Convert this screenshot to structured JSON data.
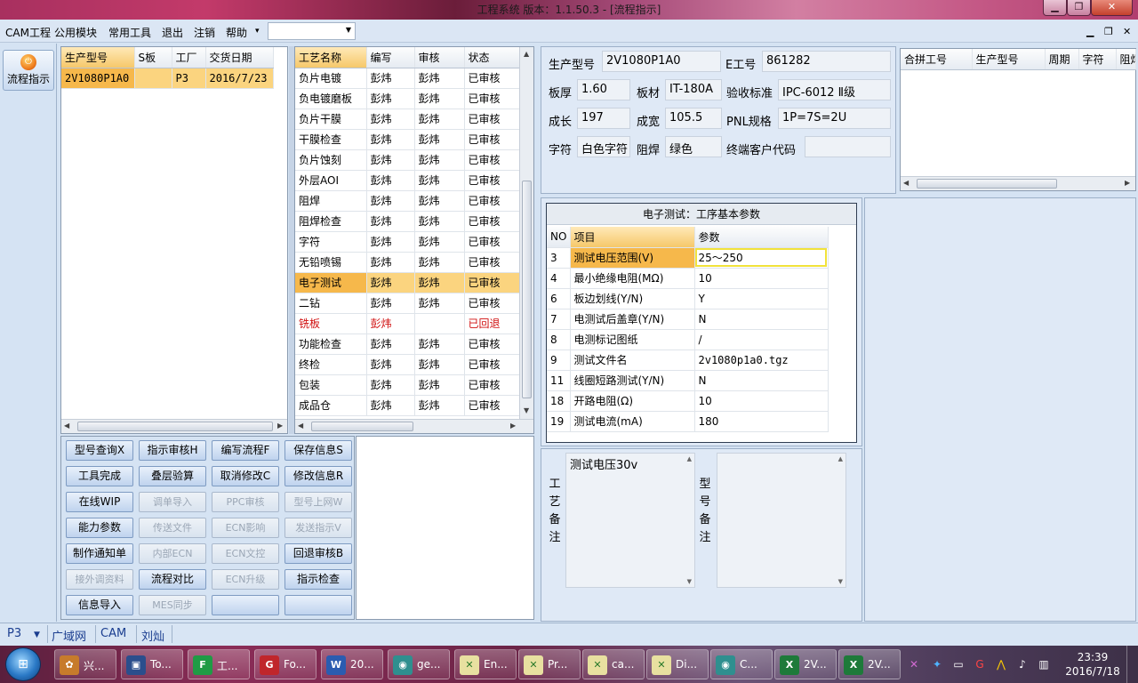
{
  "window": {
    "title": "工程系统   版本：1.1.50.3 - [流程指示]"
  },
  "menu": {
    "items": [
      "CAM工程",
      "公用模块",
      "常用工具",
      "退出",
      "注销",
      "帮助"
    ],
    "combo_value": ""
  },
  "nav": {
    "flow_label": "流程指示"
  },
  "model_grid": {
    "headers": [
      "生产型号",
      "S板",
      "工厂",
      "交货日期"
    ],
    "rows": [
      {
        "model": "2V1080P1A0",
        "s": "",
        "factory": "P3",
        "date": "2016/7/23"
      }
    ]
  },
  "process_grid": {
    "headers": [
      "工艺名称",
      "编写",
      "审核",
      "状态"
    ],
    "rows": [
      {
        "name": "负片电镀",
        "writer": "彭炜",
        "reviewer": "彭炜",
        "status": "已审核"
      },
      {
        "name": "负电镀磨板",
        "writer": "彭炜",
        "reviewer": "彭炜",
        "status": "已审核"
      },
      {
        "name": "负片干膜",
        "writer": "彭炜",
        "reviewer": "彭炜",
        "status": "已审核"
      },
      {
        "name": "干膜检查",
        "writer": "彭炜",
        "reviewer": "彭炜",
        "status": "已审核"
      },
      {
        "name": "负片蚀刻",
        "writer": "彭炜",
        "reviewer": "彭炜",
        "status": "已审核"
      },
      {
        "name": "外层AOI",
        "writer": "彭炜",
        "reviewer": "彭炜",
        "status": "已审核"
      },
      {
        "name": "阻焊",
        "writer": "彭炜",
        "reviewer": "彭炜",
        "status": "已审核"
      },
      {
        "name": "阻焊检查",
        "writer": "彭炜",
        "reviewer": "彭炜",
        "status": "已审核"
      },
      {
        "name": "字符",
        "writer": "彭炜",
        "reviewer": "彭炜",
        "status": "已审核"
      },
      {
        "name": "无铅喷锡",
        "writer": "彭炜",
        "reviewer": "彭炜",
        "status": "已审核"
      },
      {
        "name": "电子测试",
        "writer": "彭炜",
        "reviewer": "彭炜",
        "status": "已审核"
      },
      {
        "name": "二钻",
        "writer": "彭炜",
        "reviewer": "彭炜",
        "status": "已审核"
      },
      {
        "name": "铣板",
        "writer": "彭炜",
        "reviewer": "",
        "status": "已回退"
      },
      {
        "name": "功能检查",
        "writer": "彭炜",
        "reviewer": "彭炜",
        "status": "已审核"
      },
      {
        "name": "终检",
        "writer": "彭炜",
        "reviewer": "彭炜",
        "status": "已审核"
      },
      {
        "name": "包装",
        "writer": "彭炜",
        "reviewer": "彭炜",
        "status": "已审核"
      },
      {
        "name": "成品仓",
        "writer": "彭炜",
        "reviewer": "彭炜",
        "status": "已审核"
      }
    ]
  },
  "buttons": [
    [
      "型号查询X",
      "指示审核H",
      "编写流程F",
      "保存信息S"
    ],
    [
      "工具完成",
      "叠层验算",
      "取消修改C",
      "修改信息R"
    ],
    [
      "在线WIP",
      "调单导入",
      "PPC审核",
      "型号上网W"
    ],
    [
      "能力参数",
      "传送文件",
      "ECN影响",
      "发送指示V"
    ],
    [
      "制作通知单",
      "内部ECN",
      "ECN文控",
      "回退审核B"
    ],
    [
      "接外调资料",
      "流程对比",
      "ECN升级",
      "指示检查"
    ],
    [
      "信息导入",
      "MES同步",
      "",
      ""
    ]
  ],
  "info": {
    "model_label": "生产型号",
    "model_value": "2V1080P1A0",
    "e_label": "E工号",
    "e_value": "861282",
    "thickness_label": "板厚",
    "thickness_value": "1.60",
    "material_label": "板材",
    "material_value": "IT-180A",
    "standard_label": "验收标准",
    "standard_value": "IPC-6012 Ⅱ级",
    "length_label": "成长",
    "length_value": "197",
    "width_label": "成宽",
    "width_value": "105.5",
    "pnl_label": "PNL规格",
    "pnl_value": "1P=7S=2U",
    "char_label": "字符",
    "char_value": "白色字符",
    "mask_label": "阻焊",
    "mask_value": "绿色",
    "customer_label": "终端客户代码",
    "customer_value": ""
  },
  "merge_grid": {
    "headers": [
      "合拼工号",
      "生产型号",
      "周期",
      "字符",
      "阻焊"
    ]
  },
  "params": {
    "title": "电子测试：工序基本参数",
    "headers": [
      "NO",
      "项目",
      "参数"
    ],
    "rows": [
      {
        "no": "3",
        "item": "测试电压范围(V)",
        "value": "25～250"
      },
      {
        "no": "4",
        "item": "最小绝缘电阻(MΩ)",
        "value": "10"
      },
      {
        "no": "6",
        "item": "板边划线(Y/N)",
        "value": "Y"
      },
      {
        "no": "7",
        "item": "电测试后盖章(Y/N)",
        "value": "N"
      },
      {
        "no": "8",
        "item": "电测标记图纸",
        "value": "/"
      },
      {
        "no": "9",
        "item": "测试文件名",
        "value": "2v1080p1a0.tgz"
      },
      {
        "no": "11",
        "item": "线圈短路测试(Y/N)",
        "value": "N"
      },
      {
        "no": "18",
        "item": "开路电阻(Ω)",
        "value": "10"
      },
      {
        "no": "19",
        "item": "测试电流(mA)",
        "value": "180"
      }
    ]
  },
  "remarks": {
    "process_label": "工艺备注",
    "process_text": "测试电压30v",
    "model_label": "型号备注",
    "model_text": ""
  },
  "status": {
    "factory": "P3",
    "net": "广域网",
    "dept": "CAM",
    "user": "刘灿"
  },
  "taskbar": {
    "tasks": [
      "兴...",
      "To...",
      "工...",
      "Fo...",
      "20...",
      "ge...",
      "En...",
      "Pr...",
      "ca...",
      "Di...",
      "C...",
      "2V...",
      "2V..."
    ],
    "time": "23:39",
    "date": "2016/7/18"
  }
}
